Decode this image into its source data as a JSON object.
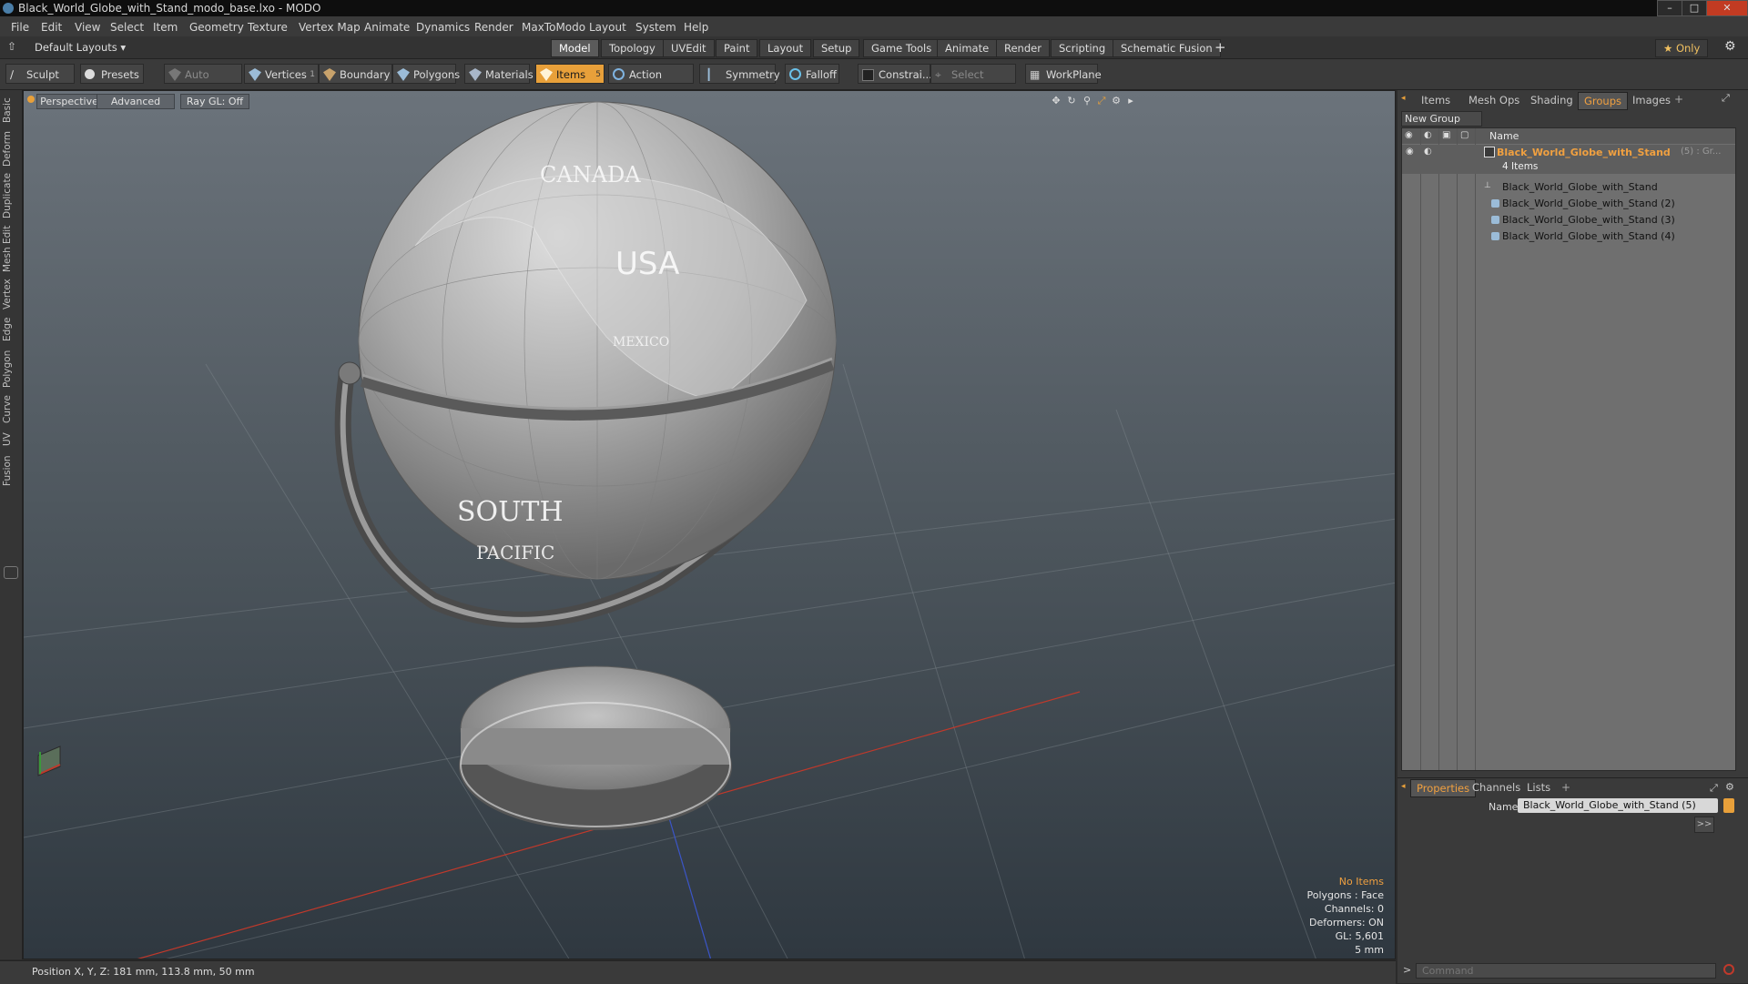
{
  "window": {
    "title": "Black_World_Globe_with_Stand_modo_base.lxo - MODO",
    "minimize": "–",
    "maximize": "□",
    "close": "✕"
  },
  "menu": [
    "File",
    "Edit",
    "View",
    "Select",
    "Item",
    "Geometry",
    "Texture",
    "Vertex Map",
    "Animate",
    "Dynamics",
    "Render",
    "MaxToModo",
    "Layout",
    "System",
    "Help"
  ],
  "layout_selector": "Default Layouts ▾",
  "layout_tabs": [
    "Model",
    "Topology",
    "UVEdit",
    "Paint",
    "Layout",
    "Setup",
    "Game Tools",
    "Animate",
    "Render",
    "Scripting",
    "Schematic Fusion"
  ],
  "layout_tab_add": "+",
  "only_button": "★ Only",
  "toolbar": {
    "sculpt": "Sculpt",
    "presets": "Presets",
    "auto_select": "Auto Select",
    "vertices": "Vertices",
    "vertices_count": "1",
    "boundary": "Boundary",
    "polygons": "Polygons",
    "materials": "Materials",
    "items": "Items",
    "items_count": "5",
    "action_center": "Action Center",
    "symmetry": "Symmetry",
    "falloff": "Falloff",
    "constraints": "Constrai...",
    "select_through": "Select Through",
    "workplane": "WorkPlane"
  },
  "left_tabs": [
    "Basic",
    "Deform",
    "Duplicate",
    "Mesh Edit",
    "Vertex",
    "Edge",
    "Polygon",
    "Curve",
    "UV",
    "Fusion"
  ],
  "viewport": {
    "view_mode": "Perspective",
    "shading": "Advanced",
    "raygl": "Ray GL: Off",
    "globe_labels": [
      "CANADA",
      "USA",
      "MEXICO",
      "SOUTH",
      "PACIFIC"
    ],
    "stats": {
      "selection": "No Items",
      "polygons": "Polygons : Face",
      "channels": "Channels: 0",
      "deformers": "Deformers: ON",
      "gl": "GL: 5,601",
      "grid": "5 mm"
    }
  },
  "right_panel": {
    "tabs": [
      "Items",
      "Mesh Ops",
      "Shading",
      "Groups",
      "Images"
    ],
    "active_tab": "Groups",
    "new_group": "New Group",
    "name_header": "Name",
    "group": {
      "name": "Black_World_Globe_with_Stand",
      "count_suffix": "(5) : Gr...",
      "items_count": "4 Items",
      "children": [
        "Black_World_Globe_with_Stand",
        "Black_World_Globe_with_Stand (2)",
        "Black_World_Globe_with_Stand (3)",
        "Black_World_Globe_with_Stand (4)"
      ]
    },
    "bottom_tabs": [
      "Properties",
      "Channels",
      "Lists"
    ],
    "name_label": "Name",
    "name_value": "Black_World_Globe_with_Stand (5)",
    "expand_button": ">>"
  },
  "status": {
    "position": "Position X, Y, Z:  181 mm, 113.8 mm, 50 mm"
  },
  "command": {
    "placeholder": "Command"
  },
  "colors": {
    "accent": "#e8a03a",
    "group_name": "#f0a040"
  }
}
